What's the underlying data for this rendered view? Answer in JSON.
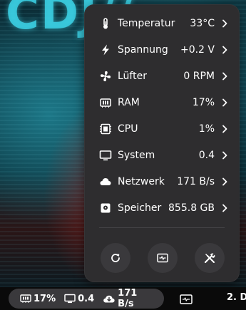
{
  "menu": {
    "items": [
      {
        "icon": "thermometer-icon",
        "label": "Temperatur",
        "value": "33°C"
      },
      {
        "icon": "lightning-icon",
        "label": "Spannung",
        "value": "+0.2 V"
      },
      {
        "icon": "fan-icon",
        "label": "Lüfter",
        "value": "0 RPM"
      },
      {
        "icon": "memory-icon",
        "label": "RAM",
        "value": "17%"
      },
      {
        "icon": "cpu-icon",
        "label": "CPU",
        "value": "1%"
      },
      {
        "icon": "monitor-icon",
        "label": "System",
        "value": "0.4"
      },
      {
        "icon": "cloud-icon",
        "label": "Netzwerk",
        "value": "171 B/s"
      },
      {
        "icon": "disk-icon",
        "label": "Speicher",
        "value": "855.8 GB"
      }
    ],
    "buttons": [
      {
        "icon": "refresh-icon"
      },
      {
        "icon": "system-monitor-icon"
      },
      {
        "icon": "tools-icon"
      }
    ]
  },
  "panel": {
    "ram": "17%",
    "system": "0.4",
    "network": "171 B/s",
    "workspace": "2. D"
  },
  "colors": {
    "popup_bg": "#2e2d2f",
    "button_bg": "#3a393c",
    "panel_bg": "#0a0a0a",
    "text": "#ffffff"
  }
}
